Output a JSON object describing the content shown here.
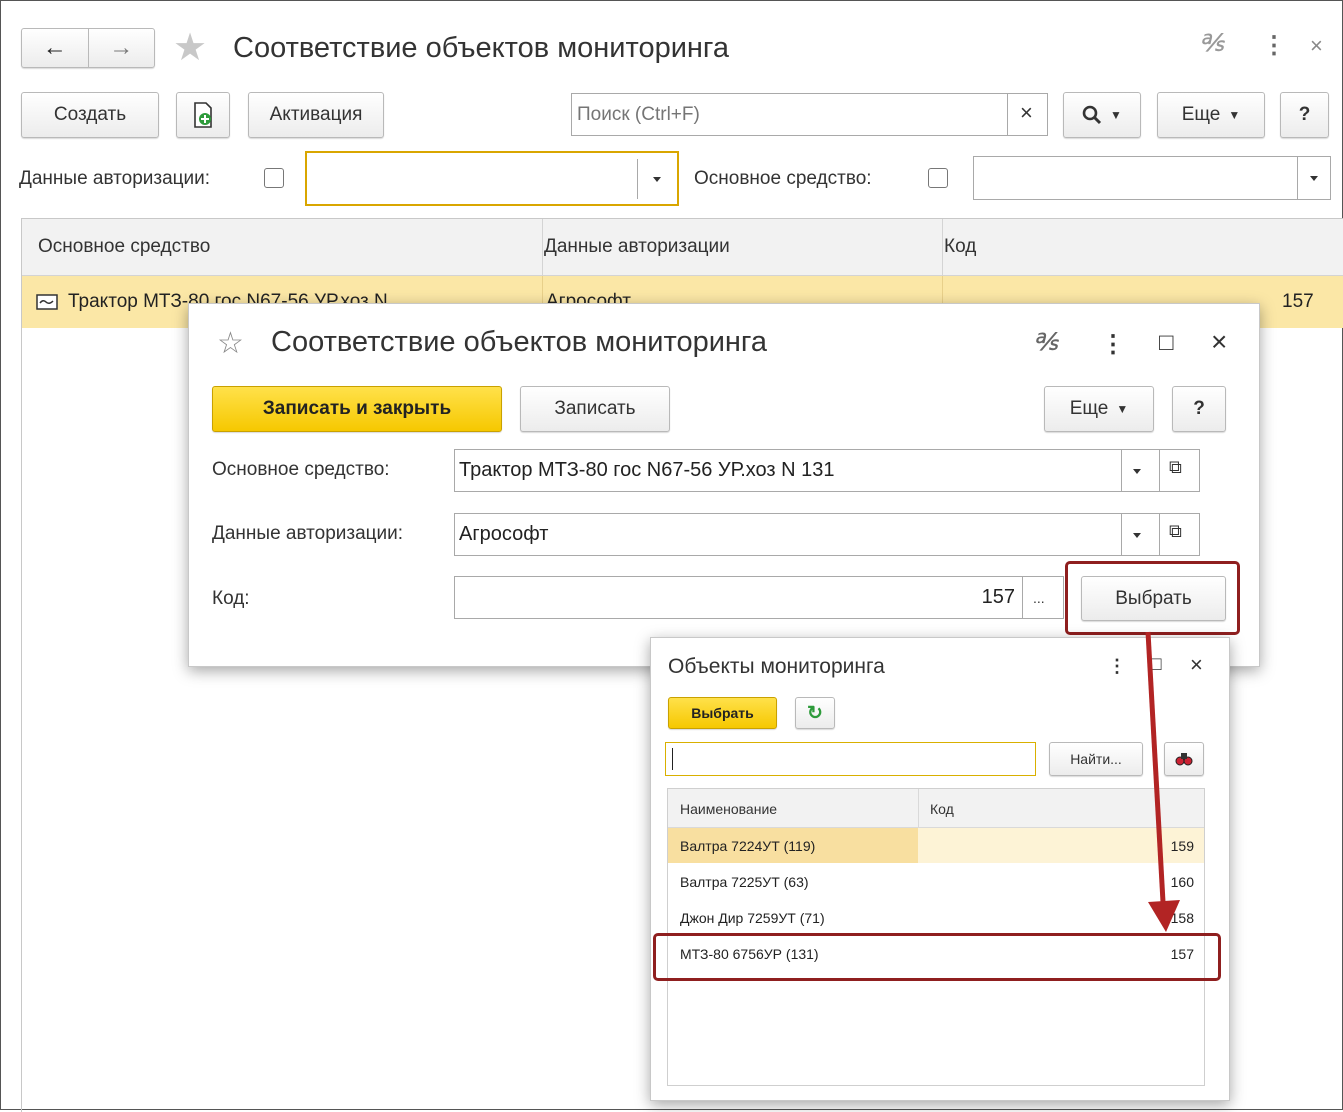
{
  "main": {
    "title": "Соответствие объектов мониторинга",
    "toolbar": {
      "create": "Создать",
      "activation": "Активация",
      "search_placeholder": "Поиск (Ctrl+F)",
      "search_clear": "×",
      "more": "Еще",
      "help": "?"
    },
    "filters": {
      "auth_label": "Данные авторизации:",
      "auth_value": "",
      "asset_label": "Основное средство:",
      "asset_value": ""
    },
    "table": {
      "columns": [
        "Основное средство",
        "Данные авторизации",
        "Код"
      ],
      "rows": [
        {
          "asset": "Трактор МТЗ-80 гос N67-56  УР.хоз N...",
          "auth": "Агрософт",
          "code": "157"
        }
      ]
    }
  },
  "form": {
    "title": "Соответствие объектов мониторинга",
    "save_close": "Записать и закрыть",
    "save": "Записать",
    "more": "Еще",
    "help": "?",
    "asset_label": "Основное средство:",
    "asset_value": "Трактор МТЗ-80 гос N67-56  УР.хоз N 131",
    "auth_label": "Данные авторизации:",
    "auth_value": "Агрософт",
    "code_label": "Код:",
    "code_value": "157",
    "ellipsis": "...",
    "select": "Выбрать"
  },
  "picker": {
    "title": "Объекты мониторинга",
    "select": "Выбрать",
    "search_value": "",
    "find": "Найти...",
    "columns": [
      "Наименование",
      "Код"
    ],
    "rows": [
      {
        "name": "Валтра 7224УТ (119)",
        "code": "159"
      },
      {
        "name": "Валтра 7225УТ (63)",
        "code": "160"
      },
      {
        "name": "Джон Дир 7259УТ (71)",
        "code": "158"
      },
      {
        "name": "МТЗ-80 6756УР (131)",
        "code": "157"
      }
    ]
  },
  "colors": {
    "accent_yellow": "#ffd21c",
    "selected_row": "#fbe7a6",
    "highlight_red": "#8f1f1f"
  }
}
